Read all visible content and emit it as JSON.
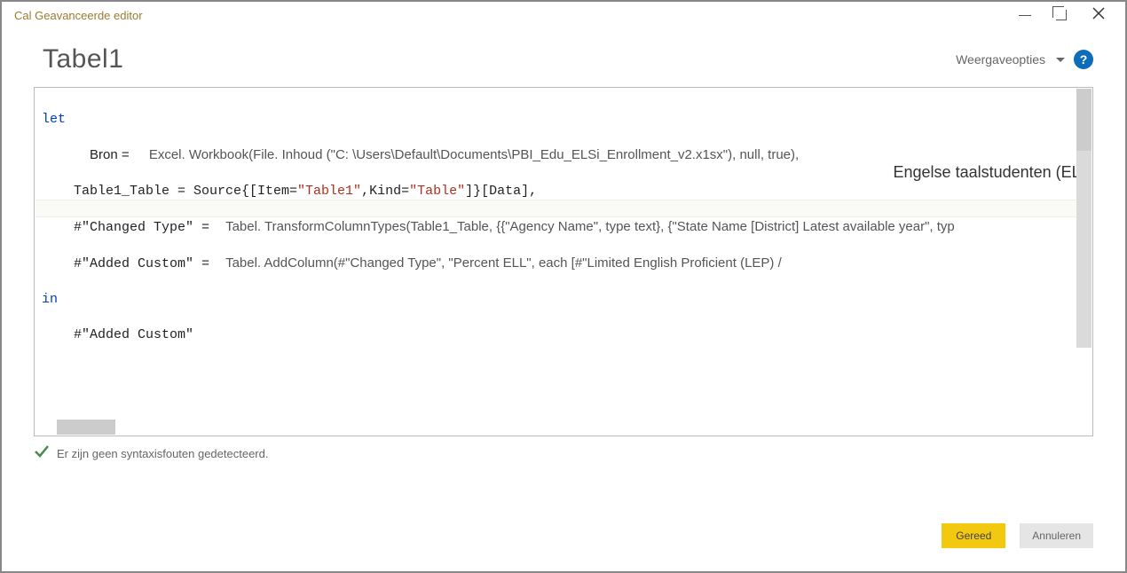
{
  "window": {
    "title": "Cal Geavanceerde editor"
  },
  "header": {
    "page_title": "Tabel1",
    "display_options_label": "Weergaveopties"
  },
  "editor": {
    "kw_let": "let",
    "line2_label": "Bron = ",
    "line2_call": "Excel. Workbook(File. Inhoud (\"C: \\Users\\Default\\Documents\\PBI_Edu_ELSi_Enrollment_v2.x1sx\"), null, true),",
    "line3_pre": "    Table1_Table = Source{[Item=",
    "line3_str1": "\"Table1\"",
    "line3_mid": ",Kind=",
    "line3_str2": "\"Table\"",
    "line3_post": "]}[Data],",
    "line4_pre": "    #\"Changed Type\" = ",
    "line4_call": "Tabel. TransformColumnTypes(Table1_Table, {{\"Agency Name\", type text}, {\"State Name [District] Latest available year\", typ",
    "line5_pre": "    #\"Added Custom\" = ",
    "line5_call": "Tabel. AddColumn(#\"Changed Type\", \"Percent ELL\", each [#\"Limited English Proficient (LEP) /",
    "overlay_text": "Engelse taalstudenten (EL :",
    "kw_in": "in",
    "line7": "    #\"Added Custom\""
  },
  "status": {
    "text": "Er zijn geen syntaxisfouten gedetecteerd."
  },
  "buttons": {
    "done": "Gereed",
    "cancel": "Annuleren"
  }
}
